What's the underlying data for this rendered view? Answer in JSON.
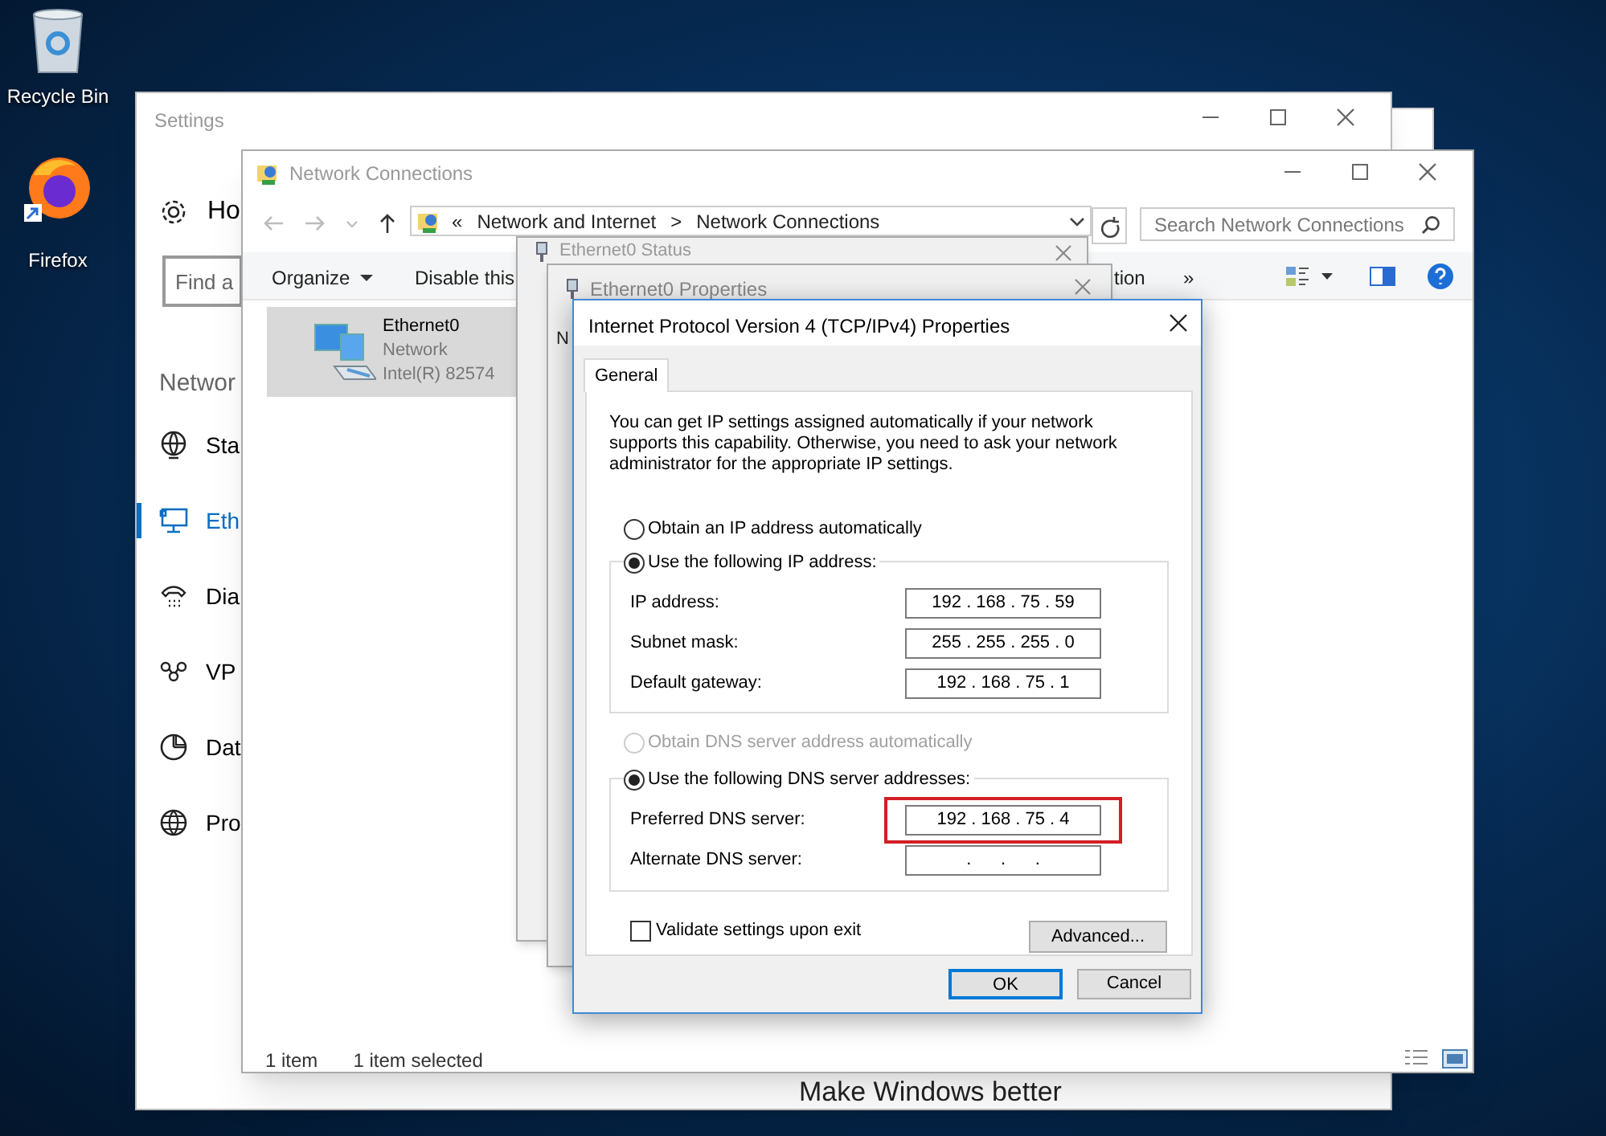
{
  "desktop_icons": [
    {
      "label": "Recycle Bin",
      "kind": "recycle"
    },
    {
      "label": "Firefox",
      "kind": "browser"
    }
  ],
  "settings_window": {
    "title": "Settings",
    "home": "Ho",
    "search_placeholder": "Find a",
    "section": "Networ",
    "nav": [
      {
        "label": "Sta",
        "kind": "status",
        "selected": false
      },
      {
        "label": "Eth",
        "kind": "ethernet",
        "selected": true
      },
      {
        "label": "Dia",
        "kind": "dialup",
        "selected": false
      },
      {
        "label": "VP",
        "kind": "vpn",
        "selected": false
      },
      {
        "label": "Dat",
        "kind": "data",
        "selected": false
      },
      {
        "label": "Pro",
        "kind": "proxy",
        "selected": false
      }
    ],
    "footer_text": "Make Windows better"
  },
  "network_window": {
    "title": "Network Connections",
    "breadcrumb": [
      "«",
      "Network and Internet",
      ">",
      "Network Connections"
    ],
    "search_placeholder": "Search Network Connections",
    "toolbar": [
      "Organize",
      "Disable this",
      "tion",
      "»"
    ],
    "items": [
      {
        "name": "Ethernet0",
        "status": "Network",
        "adapter": "Intel(R) 82574",
        "selected": true
      }
    ],
    "status_bar": [
      "1 item",
      "1 item selected"
    ]
  },
  "status_window": {
    "title": "Ethernet0 Status"
  },
  "properties_window": {
    "title": "Ethernet0 Properties",
    "fragment": "N"
  },
  "ipv4_dialog": {
    "title": "Internet Protocol Version 4 (TCP/IPv4) Properties",
    "tabs": [
      {
        "label": "General",
        "selected": true
      }
    ],
    "description": "You can get IP settings assigned automatically if your network supports this capability. Otherwise, you need to ask your network administrator for the appropriate IP settings.",
    "ip_mode": [
      {
        "label": "Obtain an IP address automatically",
        "selected": false,
        "disabled": false
      },
      {
        "label": "Use the following IP address:",
        "selected": true,
        "disabled": false
      }
    ],
    "ip_fields": [
      {
        "label": "IP address:",
        "value": "192 . 168 . 75 . 59",
        "highlighted": false
      },
      {
        "label": "Subnet mask:",
        "value": "255 . 255 . 255 . 0",
        "highlighted": false
      },
      {
        "label": "Default gateway:",
        "value": "192 . 168 . 75 . 1",
        "highlighted": false
      }
    ],
    "dns_mode": [
      {
        "label": "Obtain DNS server address automatically",
        "selected": false,
        "disabled": true
      },
      {
        "label": "Use the following DNS server addresses:",
        "selected": true,
        "disabled": false
      }
    ],
    "dns_fields": [
      {
        "label": "Preferred DNS server:",
        "value": "192 . 168 . 75 . 4",
        "highlighted": true
      },
      {
        "label": "Alternate DNS server:",
        "value": ".      .      .",
        "highlighted": false
      }
    ],
    "validate": {
      "label": "Validate settings upon exit",
      "checked": false
    },
    "advanced_button": "Advanced...",
    "buttons": [
      {
        "label": "OK",
        "default": true
      },
      {
        "label": "Cancel",
        "default": false
      }
    ]
  }
}
